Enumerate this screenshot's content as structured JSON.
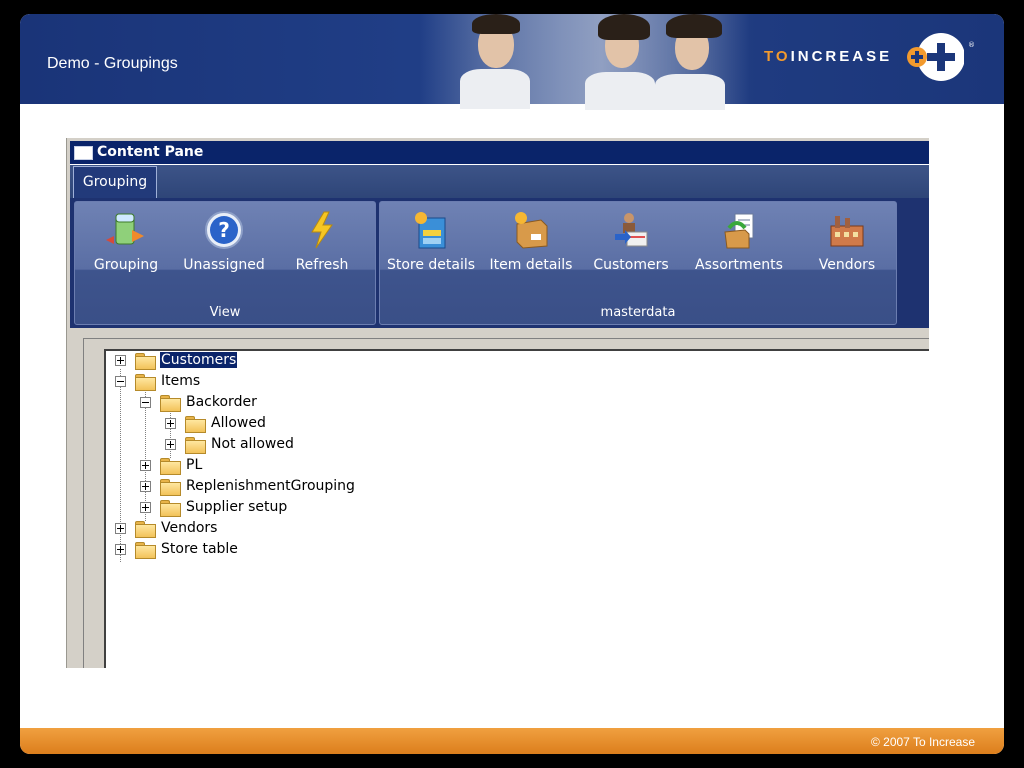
{
  "slide": {
    "title": "Demo - Groupings",
    "logo": {
      "prefix": "TO",
      "text": "INCREASE",
      "registered": "®"
    },
    "footer": "© 2007 To Increase"
  },
  "app": {
    "window_title": "Content Pane",
    "tabs": [
      {
        "label": "Grouping",
        "active": true
      }
    ],
    "ribbon": {
      "groups": [
        {
          "label": "View",
          "buttons": [
            {
              "label": "Grouping",
              "icon": "grouping-icon"
            },
            {
              "label": "Unassigned",
              "icon": "question-icon"
            },
            {
              "label": "Refresh",
              "icon": "lightning-icon"
            }
          ]
        },
        {
          "label": "masterdata",
          "buttons": [
            {
              "label": "Store details",
              "icon": "store-icon"
            },
            {
              "label": "Item details",
              "icon": "box-icon"
            },
            {
              "label": "Customers",
              "icon": "customers-icon"
            },
            {
              "label": "Assortments",
              "icon": "assortment-icon"
            },
            {
              "label": "Vendors",
              "icon": "factory-icon"
            }
          ]
        }
      ]
    },
    "tree": [
      {
        "label": "Customers",
        "level": 0,
        "expander": "plus",
        "selected": true
      },
      {
        "label": "Items",
        "level": 0,
        "expander": "minus"
      },
      {
        "label": "Backorder",
        "level": 1,
        "expander": "minus"
      },
      {
        "label": "Allowed",
        "level": 2,
        "expander": "plus"
      },
      {
        "label": "Not allowed",
        "level": 2,
        "expander": "plus"
      },
      {
        "label": "PL",
        "level": 1,
        "expander": "plus"
      },
      {
        "label": "ReplenishmentGrouping",
        "level": 1,
        "expander": "plus"
      },
      {
        "label": "Supplier setup",
        "level": 1,
        "expander": "plus"
      },
      {
        "label": "Vendors",
        "level": 0,
        "expander": "plus"
      },
      {
        "label": "Store table",
        "level": 0,
        "expander": "plus"
      }
    ]
  },
  "colors": {
    "banner": "#1a3478",
    "footer": "#e8902c",
    "title_bar": "#0a246a",
    "logo_accent": "#f29a2e"
  }
}
